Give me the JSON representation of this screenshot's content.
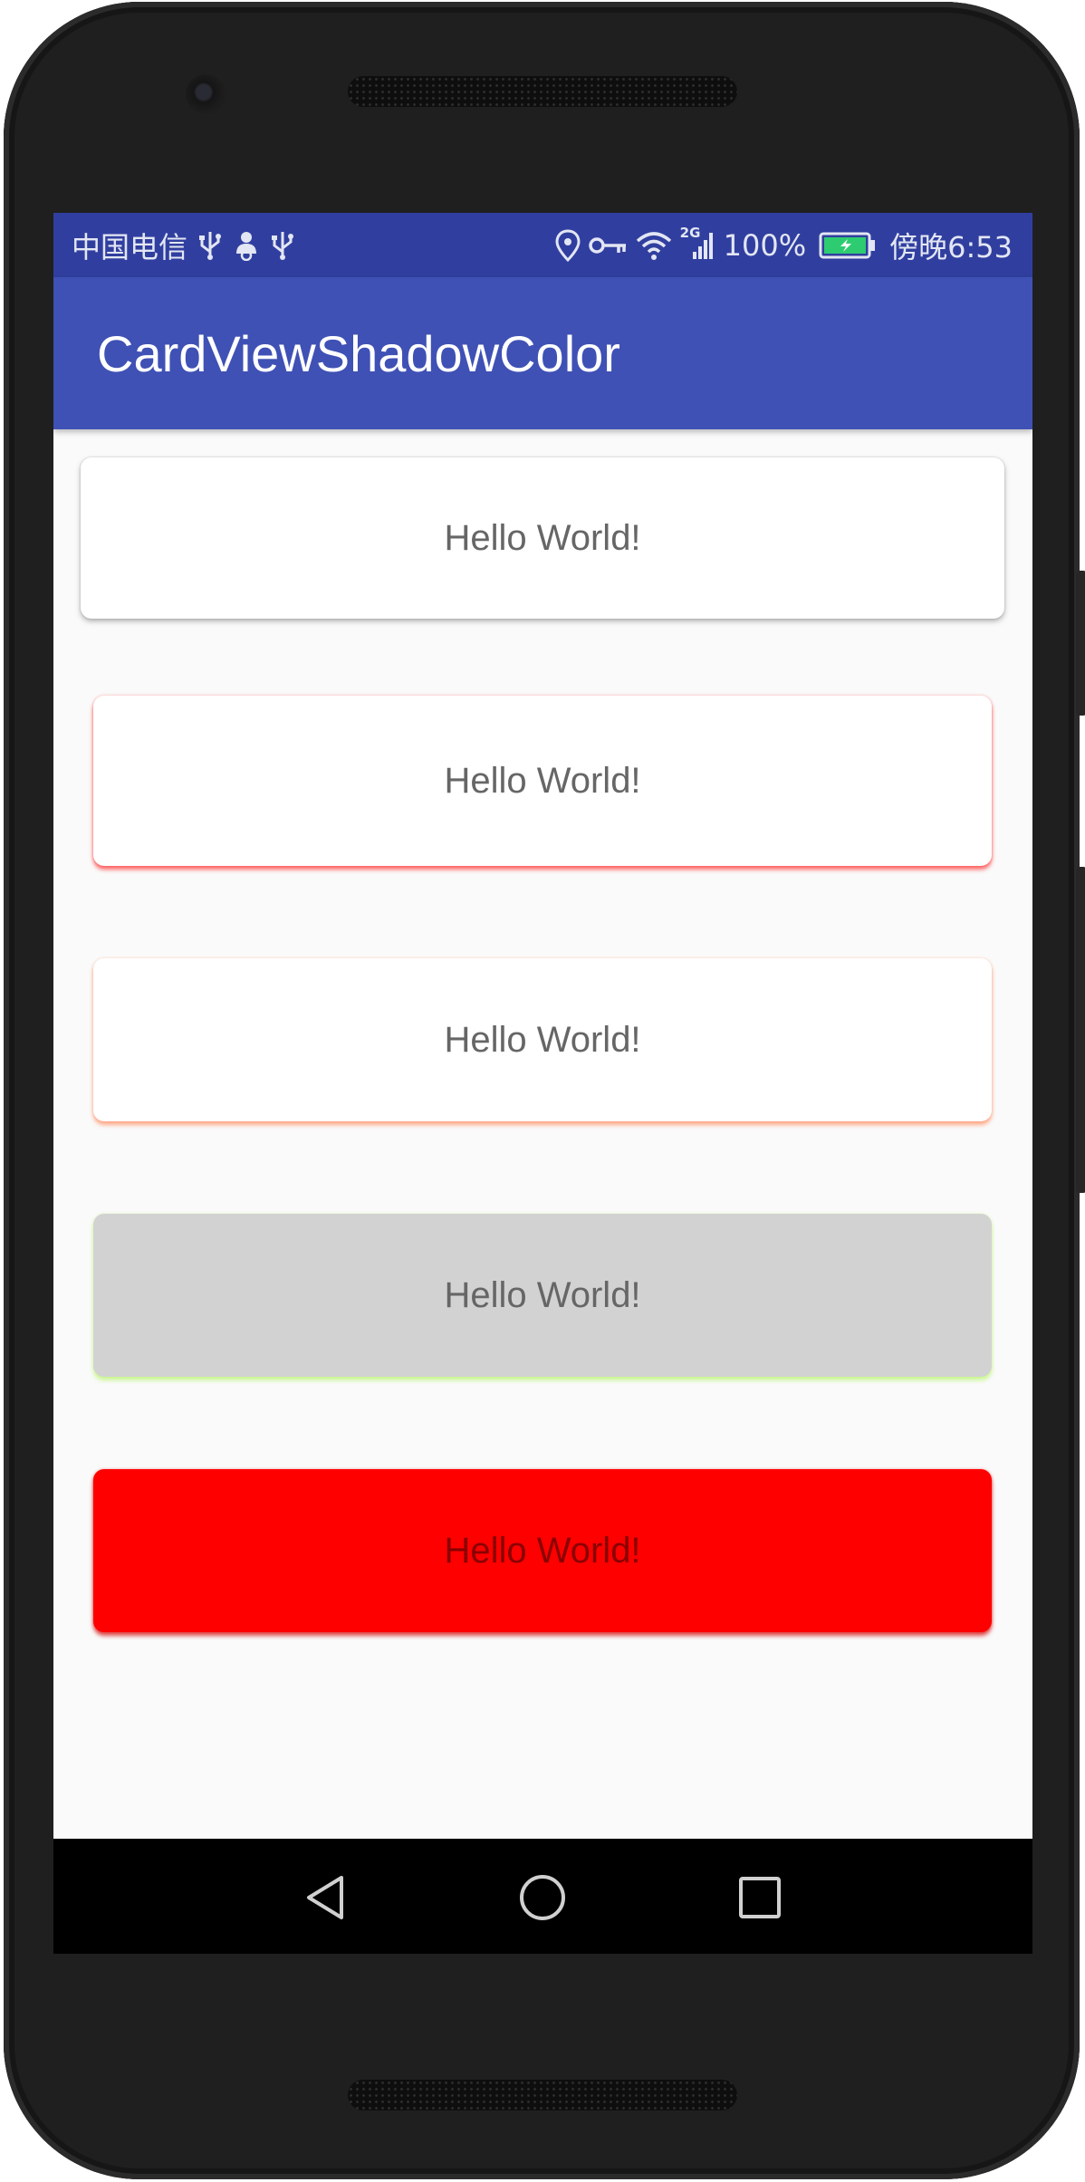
{
  "status_bar": {
    "carrier": "中国电信",
    "network_type": "2G",
    "battery": "100%",
    "time": "傍晚6:53",
    "icons": [
      "usb-icon",
      "person-icon",
      "usb-icon",
      "location-icon",
      "key-icon",
      "wifi-icon",
      "signal-icon",
      "battery-icon"
    ]
  },
  "app_bar": {
    "title": "CardViewShadowColor",
    "color": "#3f51b5",
    "status_color": "#303f9f"
  },
  "cards": [
    {
      "text": "Hello World!",
      "background": "#ffffff",
      "text_color": "#666666",
      "shadow": "#9e9e9e"
    },
    {
      "text": "Hello World!",
      "background": "#ffffff",
      "text_color": "#666666",
      "shadow": "#ff2a2a"
    },
    {
      "text": "Hello World!",
      "background": "#ffffff",
      "text_color": "#666666",
      "shadow": "#ff8a5c"
    },
    {
      "text": "Hello World!",
      "background": "#d2d2d2",
      "text_color": "#666666",
      "shadow": "#b6f56a"
    },
    {
      "text": "Hello World!",
      "background": "#ff0000",
      "text_color": "#8a0000",
      "shadow": "#d40000"
    }
  ],
  "nav_bar": {
    "buttons": [
      "back-icon",
      "home-icon",
      "recents-icon"
    ]
  }
}
